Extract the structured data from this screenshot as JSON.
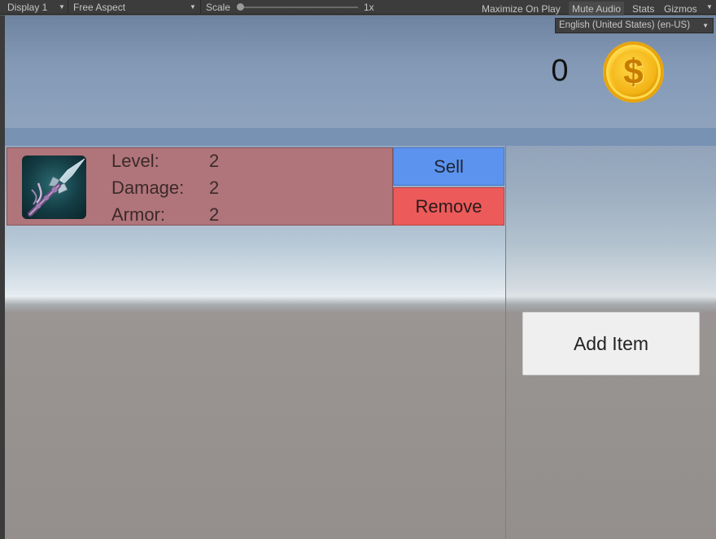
{
  "toolbar": {
    "display": "Display 1",
    "aspect": "Free Aspect",
    "scale_label": "Scale",
    "scale_value": "1x",
    "maximize": "Maximize On Play",
    "mute": "Mute Audio",
    "stats": "Stats",
    "gizmos": "Gizmos"
  },
  "language": {
    "selected": "English (United States) (en-US)"
  },
  "currency": {
    "amount": "0",
    "icon": "dollar-coin-icon",
    "symbol": "$"
  },
  "item": {
    "icon": "spear-icon",
    "stats": [
      {
        "label": "Level:",
        "value": "2"
      },
      {
        "label": "Damage:",
        "value": "2"
      },
      {
        "label": "Armor:",
        "value": "2"
      }
    ],
    "sell_label": "Sell",
    "remove_label": "Remove",
    "row_color": "#b0757a",
    "sell_color": "#5c93ee",
    "remove_color": "#ec5a5a"
  },
  "actions": {
    "add_item_label": "Add Item"
  }
}
